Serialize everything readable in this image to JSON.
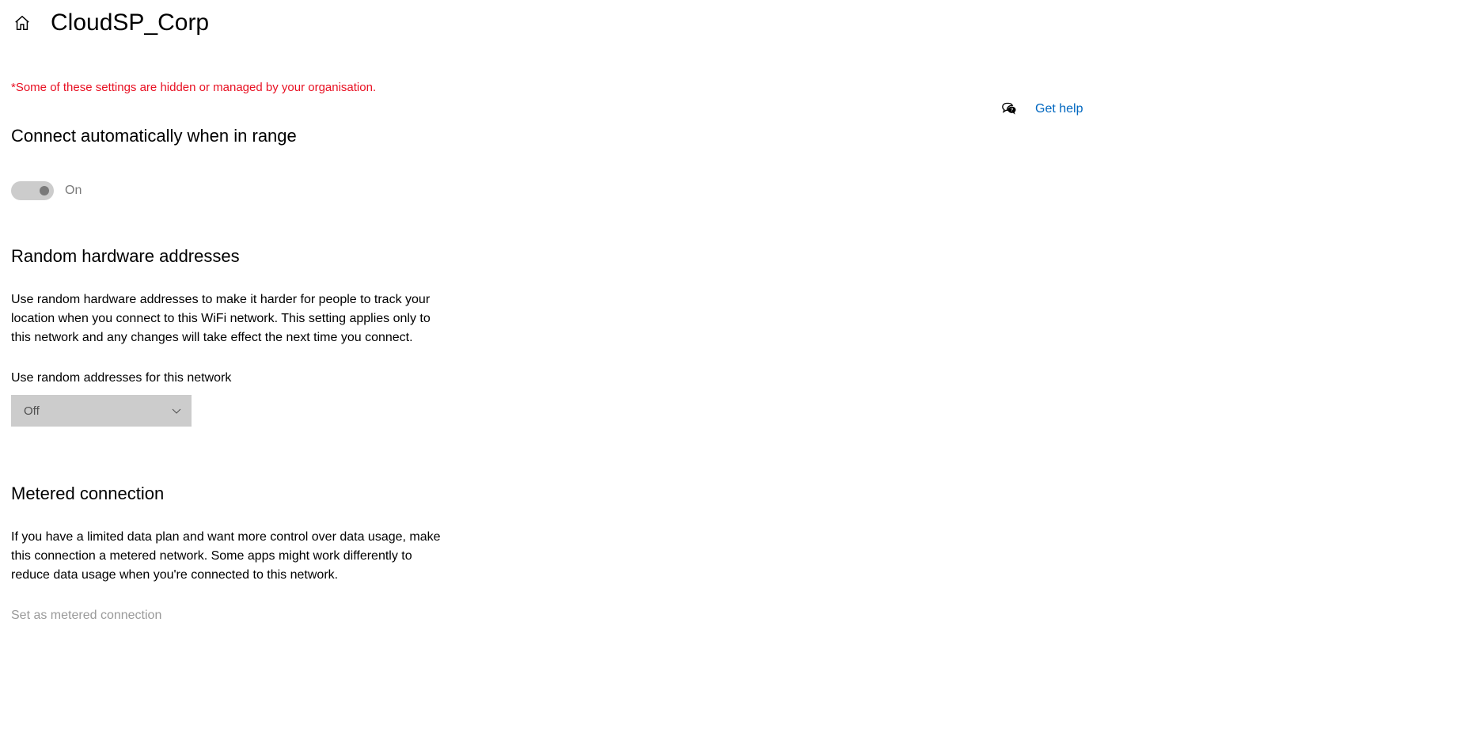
{
  "header": {
    "title": "CloudSP_Corp"
  },
  "managed_notice": "*Some of these settings are hidden or managed by your organisation.",
  "sections": {
    "auto_connect": {
      "heading": "Connect automatically when in range",
      "toggle_label": "On"
    },
    "random_hw": {
      "heading": "Random hardware addresses",
      "description": "Use random hardware addresses to make it harder for people to track your location when you connect to this WiFi network. This setting applies only to this network and any changes will take effect the next time you connect.",
      "field_label": "Use random addresses for this network",
      "select_value": "Off"
    },
    "metered": {
      "heading": "Metered connection",
      "description": "If you have a limited data plan and want more control over data usage, make this connection a metered network. Some apps might work differently to reduce data usage when you're connected to this network.",
      "disabled_label": "Set as metered connection"
    }
  },
  "help": {
    "link_text": "Get help"
  }
}
